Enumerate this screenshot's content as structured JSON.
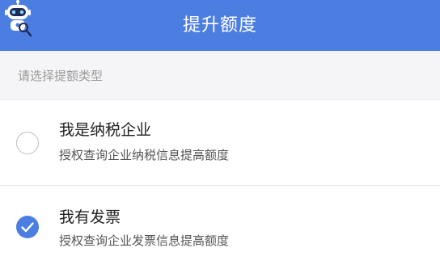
{
  "header": {
    "title": "提升额度",
    "mascot_icon": "robot-mascot-icon"
  },
  "section": {
    "label": "请选择提额类型"
  },
  "options": [
    {
      "title": "我是纳税企业",
      "description": "授权查询企业纳税信息提高额度",
      "selected": false
    },
    {
      "title": "我有发票",
      "description": "授权查询企业发票信息提高额度",
      "selected": true
    }
  ],
  "colors": {
    "header_bg": "#4b7ee0",
    "accent": "#4b7ee0",
    "section_bg": "#f5f5f7",
    "radio_unselected_border": "#bdbdbd"
  }
}
